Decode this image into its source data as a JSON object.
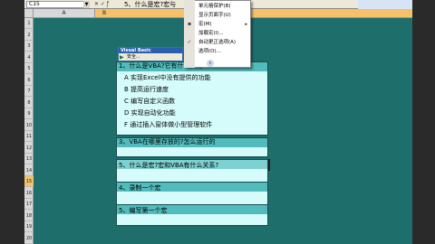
{
  "formula_bar": {
    "name_box": "C15",
    "formula_text": "5、什么是宏?宏与"
  },
  "columns": {
    "a": "A",
    "b": "B"
  },
  "row_headers": [
    "1",
    "2",
    "3",
    "4",
    "5",
    "6",
    "7",
    "8",
    "9",
    "10",
    "11",
    "12",
    "13",
    "14",
    "15",
    "16",
    "17",
    "18",
    "19",
    "20"
  ],
  "selected_row": "15",
  "menu": {
    "items": [
      {
        "label": "单元格保护(B)",
        "arrow": ""
      },
      {
        "label": "显示页面字(U)",
        "arrow": ""
      },
      {
        "label": "宏(M)",
        "arrow": "▸"
      },
      {
        "label": "加载宏(I)...",
        "arrow": ""
      },
      {
        "label": "自动更正选项(A)",
        "arrow": ""
      },
      {
        "label": "选项(O)...",
        "arrow": ""
      }
    ],
    "expand": "»"
  },
  "vb_toolbar": {
    "title": "Visual Basic",
    "security_label": "安全..."
  },
  "questions": [
    {
      "title": "1、什么是VBA?它有什么作用?",
      "options": [
        "A 实现Excel中没有提供的功能",
        "B 提高运行速度",
        "C 编写自定义函数",
        "D 实现自动化功能",
        "F 通过插入窗体做小型管理软件"
      ]
    },
    {
      "title": "3、VBA在哪里存放的?怎么运行的"
    },
    {
      "title": "5、什么是宏?宏和VBA有什么关系?"
    },
    {
      "title": "4、录制一个宏"
    },
    {
      "title": "5、编写第一个宏"
    }
  ]
}
